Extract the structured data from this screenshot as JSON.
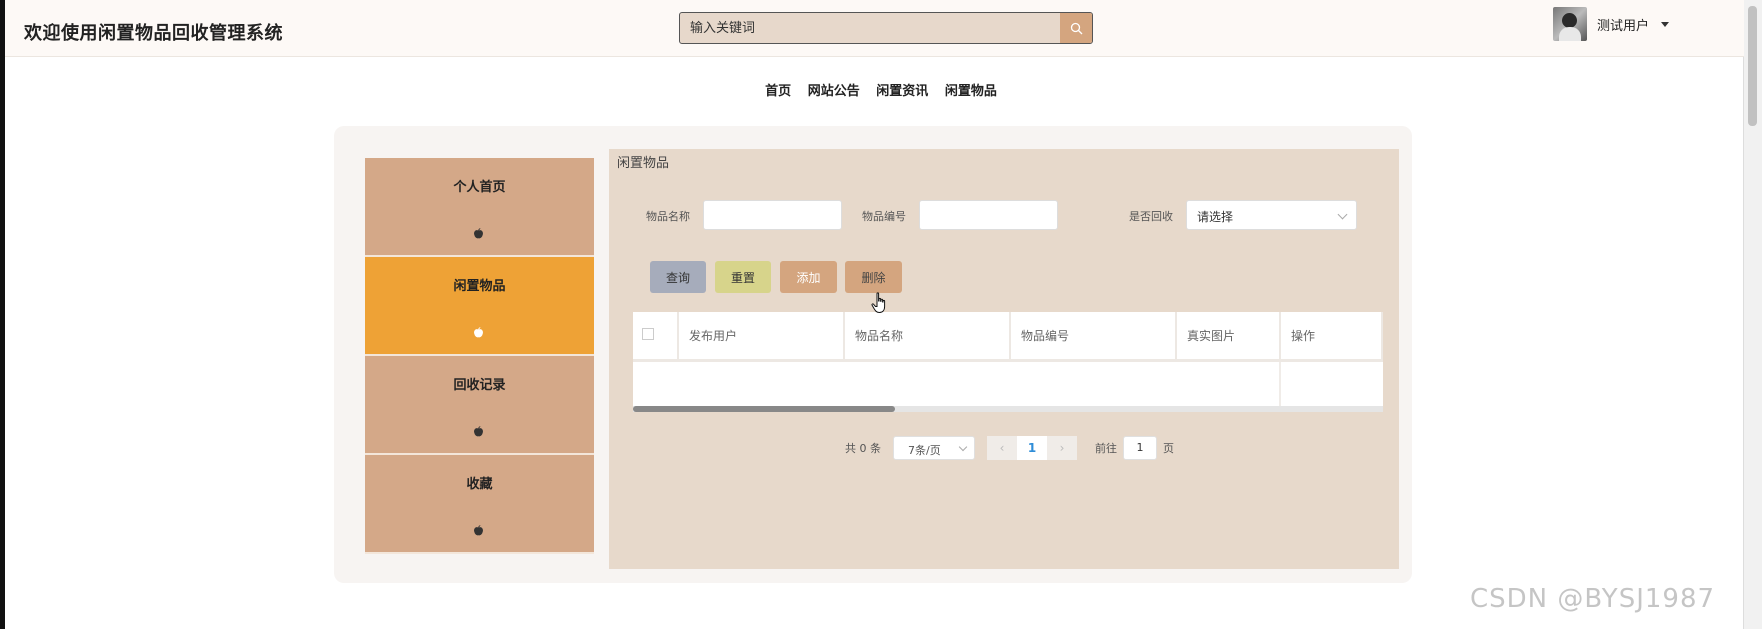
{
  "header": {
    "site_title": "欢迎使用闲置物品回收管理系统",
    "search_placeholder": "输入关键词",
    "user_name": "测试用户"
  },
  "nav": {
    "items": [
      "首页",
      "网站公告",
      "闲置资讯",
      "闲置物品"
    ]
  },
  "sidebar": {
    "items": [
      {
        "label": "个人首页",
        "active": false
      },
      {
        "label": "闲置物品",
        "active": true
      },
      {
        "label": "回收记录",
        "active": false
      },
      {
        "label": "收藏",
        "active": false
      }
    ]
  },
  "main": {
    "title": "闲置物品",
    "filters": {
      "name_label": "物品名称",
      "code_label": "物品编号",
      "recycled_label": "是否回收",
      "recycled_value": "请选择"
    },
    "buttons": {
      "query": "查询",
      "reset": "重置",
      "add": "添加",
      "delete": "删除"
    },
    "table": {
      "columns": [
        "发布用户",
        "物品名称",
        "物品编号",
        "真实图片",
        "操作"
      ],
      "rows": []
    },
    "pagination": {
      "total_text": "共 0 条",
      "page_size": "7条/页",
      "current_page": "1",
      "goto_prefix": "前往",
      "goto_value": "1",
      "goto_suffix": "页"
    }
  },
  "watermark": "CSDN @BYSJ1987",
  "colors": {
    "header_bg": "#fdf9f6",
    "sidebar_bg": "#d4a888",
    "sidebar_active": "#eea236",
    "main_bg": "#e7d9cb",
    "accent_brown": "#d4a57f"
  }
}
